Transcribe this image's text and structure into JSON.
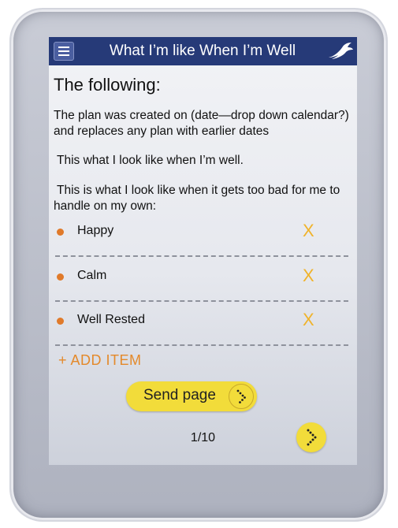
{
  "header": {
    "title": "What I’m like When I’m Well",
    "menu_icon": "hamburger-icon",
    "logo_icon": "swallow-bird-icon"
  },
  "content": {
    "heading": "The following:",
    "plan_text_line1": "The plan was created on (date—drop down calendar?)",
    "plan_text_line2": "and replaces any plan with earlier dates",
    "well_text": "This what I look like when I’m well.",
    "bad_text_line1": "This is what I look like when it gets too bad for me to",
    "bad_text_line2": "handle on my own:"
  },
  "items": [
    {
      "label": "Happy",
      "remove": "X"
    },
    {
      "label": "Calm",
      "remove": "X"
    },
    {
      "label": "Well Rested",
      "remove": "X"
    }
  ],
  "actions": {
    "add_item": "+ ADD ITEM",
    "send_page": "Send page"
  },
  "pagination": {
    "text": "1/10"
  },
  "colors": {
    "header_bg": "#263a78",
    "accent_orange": "#e4892a",
    "button_yellow": "#f2dc3a"
  }
}
